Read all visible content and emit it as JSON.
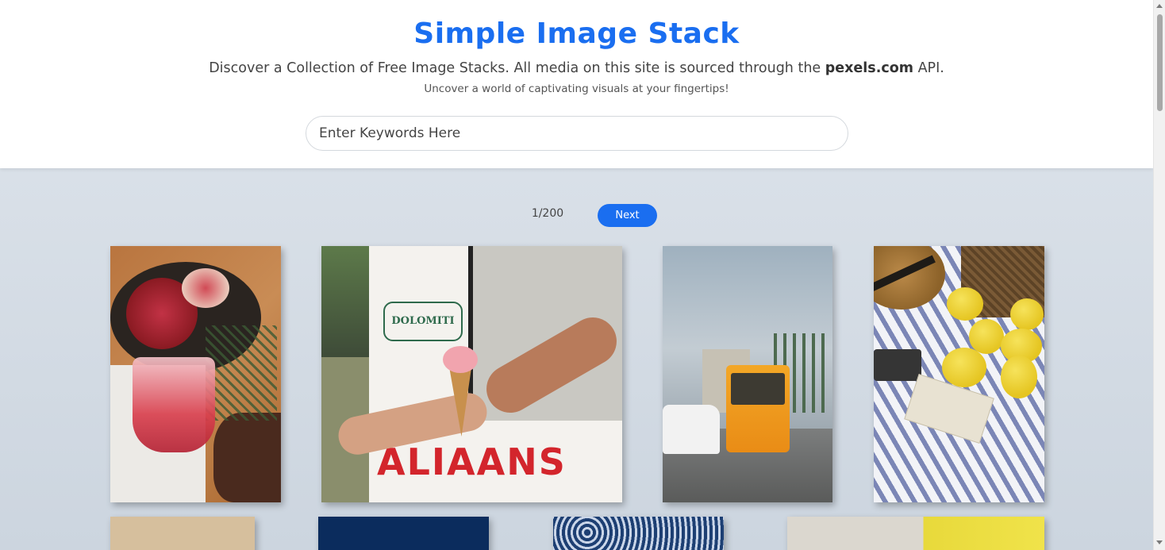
{
  "header": {
    "title": "Simple Image Stack",
    "subtitle_pre": "Discover a Collection of Free Image Stacks. All media on this site is sourced through the ",
    "subtitle_bold": "pexels.com",
    "subtitle_post": " API.",
    "tagline": "Uncover a world of captivating visuals at your fingertips!"
  },
  "search": {
    "placeholder": "Enter Keywords Here",
    "value": ""
  },
  "pagination": {
    "count": "1/200",
    "next_label": "Next"
  },
  "photos": {
    "truck_logo": "DOLOMITI",
    "truck_text": "ALIAANS"
  },
  "colors": {
    "accent": "#1a6ef0"
  }
}
